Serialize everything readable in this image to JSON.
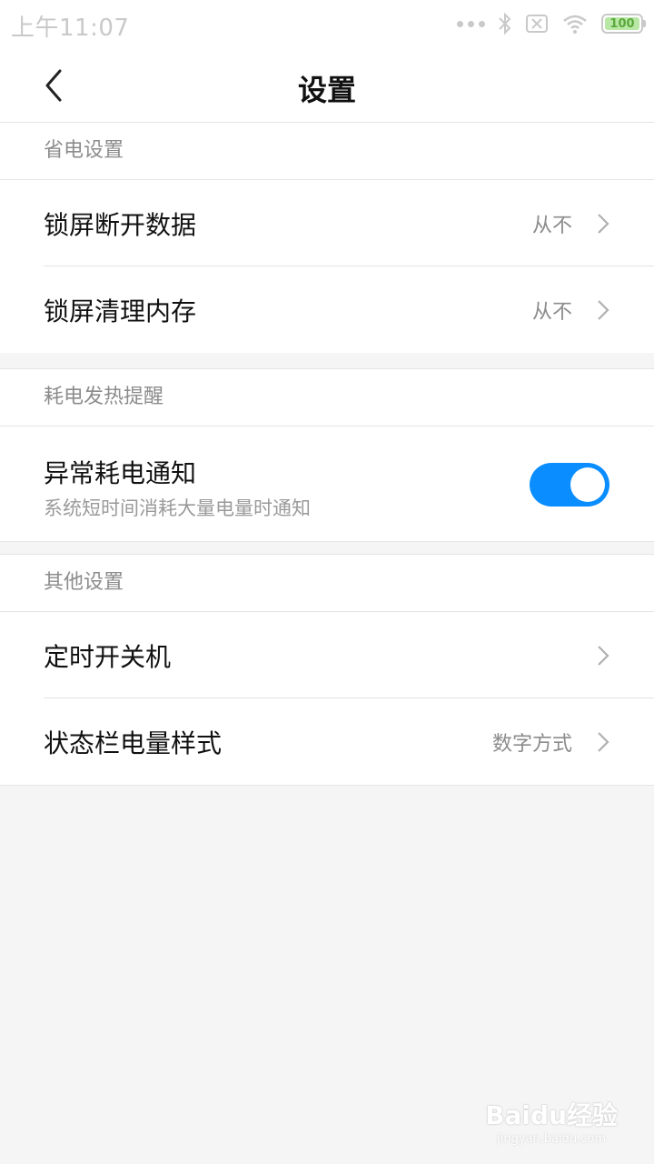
{
  "status_bar": {
    "time": "上午11:07",
    "battery_level": "100",
    "icons": [
      "more-dots-icon",
      "bluetooth-icon",
      "sim-off-icon",
      "wifi-icon",
      "battery-icon"
    ]
  },
  "header": {
    "title": "设置",
    "back_icon": "chevron-left-icon"
  },
  "sections": [
    {
      "title": "省电设置",
      "rows": [
        {
          "label": "锁屏断开数据",
          "value": "从不"
        },
        {
          "label": "锁屏清理内存",
          "value": "从不"
        }
      ]
    },
    {
      "title": "耗电发热提醒",
      "rows": [
        {
          "label": "异常耗电通知",
          "subtitle": "系统短时间消耗大量电量时通知",
          "toggle": true
        }
      ]
    },
    {
      "title": "其他设置",
      "rows": [
        {
          "label": "定时开关机",
          "value": ""
        },
        {
          "label": "状态栏电量样式",
          "value": "数字方式"
        }
      ]
    }
  ],
  "colors": {
    "accent": "#0a8dff",
    "background": "#f5f5f5",
    "surface": "#ffffff",
    "secondary_text": "#8c8c8c"
  },
  "watermark": {
    "brand": "Baidu经验",
    "url": "jingyan.baidu.com"
  }
}
